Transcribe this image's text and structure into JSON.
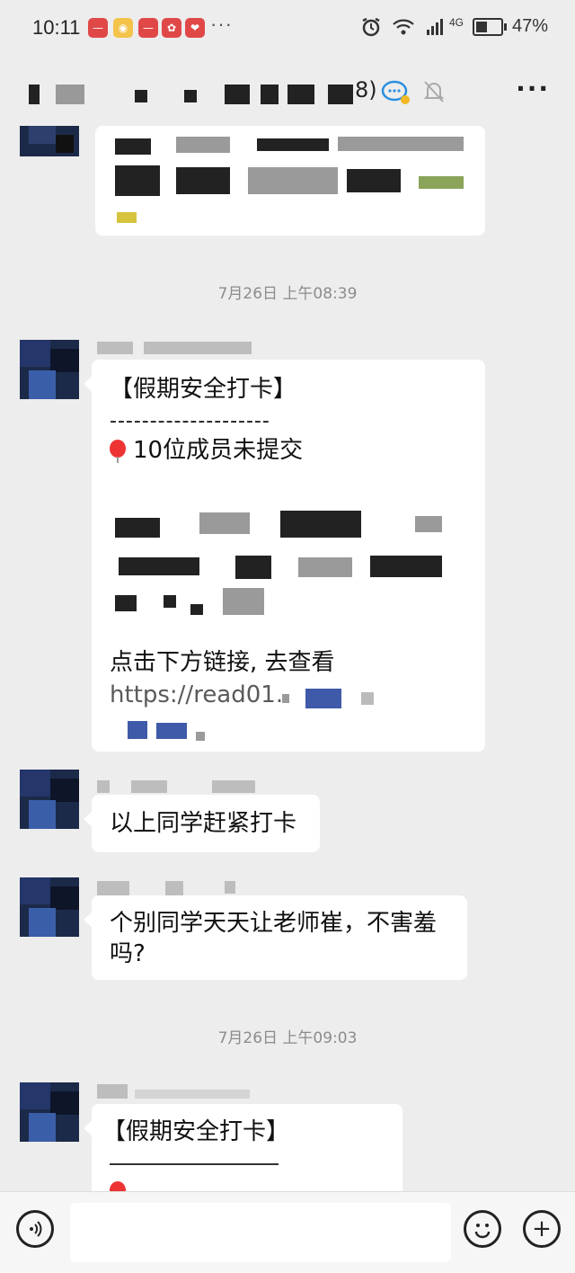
{
  "status_bar": {
    "time": "10:11",
    "more_indicator": "···",
    "battery_percent": "47%",
    "battery_level": 0.47,
    "network_label": "4G",
    "icons": [
      "alarm-icon",
      "wifi-icon",
      "signal-icon",
      "battery-icon"
    ]
  },
  "chat_header": {
    "title_suffix": "8)",
    "icons": [
      "chat-bubble-icon",
      "mute-bell-icon",
      "more-menu-icon"
    ],
    "menu_label": "···"
  },
  "messages": [
    {
      "type": "text_redacted",
      "redacted": true
    },
    {
      "type": "timestamp",
      "text": "7月26日 上午08:39"
    },
    {
      "type": "card",
      "title": "【假期安全打卡】",
      "divider": "--------------------",
      "summary": "10位成员未提交",
      "prompt": "点击下方链接, 去查看",
      "link": "https://read01."
    },
    {
      "type": "text",
      "text": "以上同学赶紧打卡"
    },
    {
      "type": "text",
      "text": "个别同学天天让老师崔，不害羞吗?"
    },
    {
      "type": "timestamp",
      "text": "7月26日 上午09:03"
    },
    {
      "type": "card_partial",
      "title": "【假期安全打卡】"
    }
  ],
  "input_bar": {
    "placeholder": "",
    "icons": [
      "voice-icon",
      "emoji-icon",
      "add-icon"
    ],
    "add_label": "+"
  },
  "colors": {
    "background": "#ededed",
    "bubble": "#ffffff",
    "timestamp": "#8c8c8c",
    "notification_badge": "#e04848"
  }
}
